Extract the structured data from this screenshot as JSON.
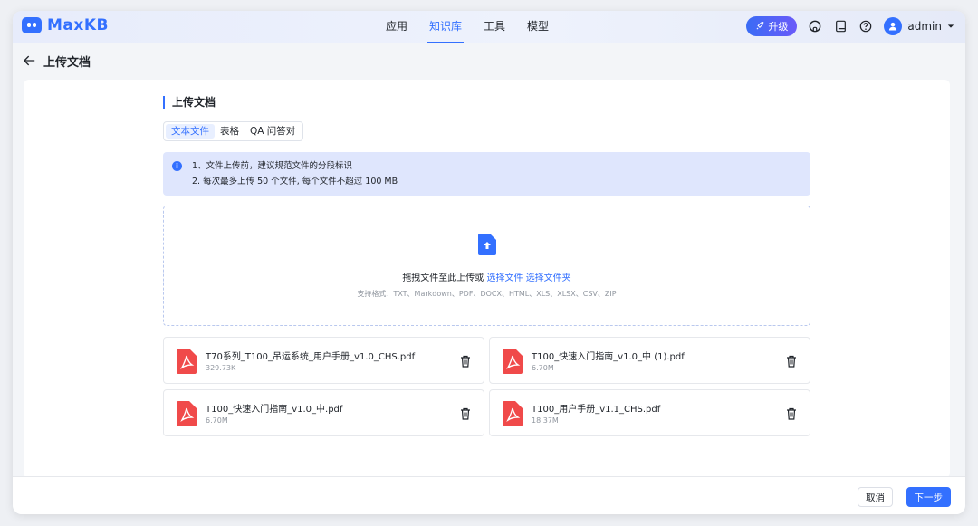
{
  "app": {
    "name": "MaxKB"
  },
  "nav": {
    "items": [
      {
        "label": "应用",
        "active": false
      },
      {
        "label": "知识库",
        "active": true
      },
      {
        "label": "工具",
        "active": false
      },
      {
        "label": "模型",
        "active": false
      }
    ]
  },
  "header": {
    "upgrade_label": "升级",
    "username": "admin"
  },
  "page": {
    "title": "上传文档"
  },
  "section": {
    "title": "上传文档"
  },
  "tabs": [
    {
      "label": "文本文件",
      "active": true
    },
    {
      "label": "表格",
      "active": false
    },
    {
      "label": "QA 问答对",
      "active": false
    }
  ],
  "alert": {
    "line1": "1、文件上传前，建议规范文件的分段标识",
    "line2": "2. 每次最多上传 50 个文件, 每个文件不超过 100 MB"
  },
  "dropzone": {
    "text": "拖拽文件至此上传或 ",
    "link_file": "选择文件",
    "link_folder": "选择文件夹",
    "hint": "支持格式：TXT、Markdown、PDF、DOCX、HTML、XLS、XLSX、CSV、ZIP"
  },
  "files": [
    {
      "name": "T70系列_T100_吊运系统_用户手册_v1.0_CHS.pdf",
      "size": "329.73K"
    },
    {
      "name": "T100_快速入门指南_v1.0_中 (1).pdf",
      "size": "6.70M"
    },
    {
      "name": "T100_快速入门指南_v1.0_中.pdf",
      "size": "6.70M"
    },
    {
      "name": "T100_用户手册_v1.1_CHS.pdf",
      "size": "18.37M"
    }
  ],
  "footer": {
    "cancel_label": "取消",
    "next_label": "下一步"
  },
  "colors": {
    "primary": "#3370ff",
    "pdf": "#f04a4a",
    "alert_bg": "#dfe6fd"
  },
  "icons": [
    "robot-logo-icon",
    "rocket-icon",
    "github-icon",
    "book-icon",
    "help-icon",
    "user-icon",
    "caret-down-icon",
    "arrow-left-icon",
    "info-icon",
    "upload-file-icon",
    "pdf-icon",
    "trash-icon"
  ]
}
